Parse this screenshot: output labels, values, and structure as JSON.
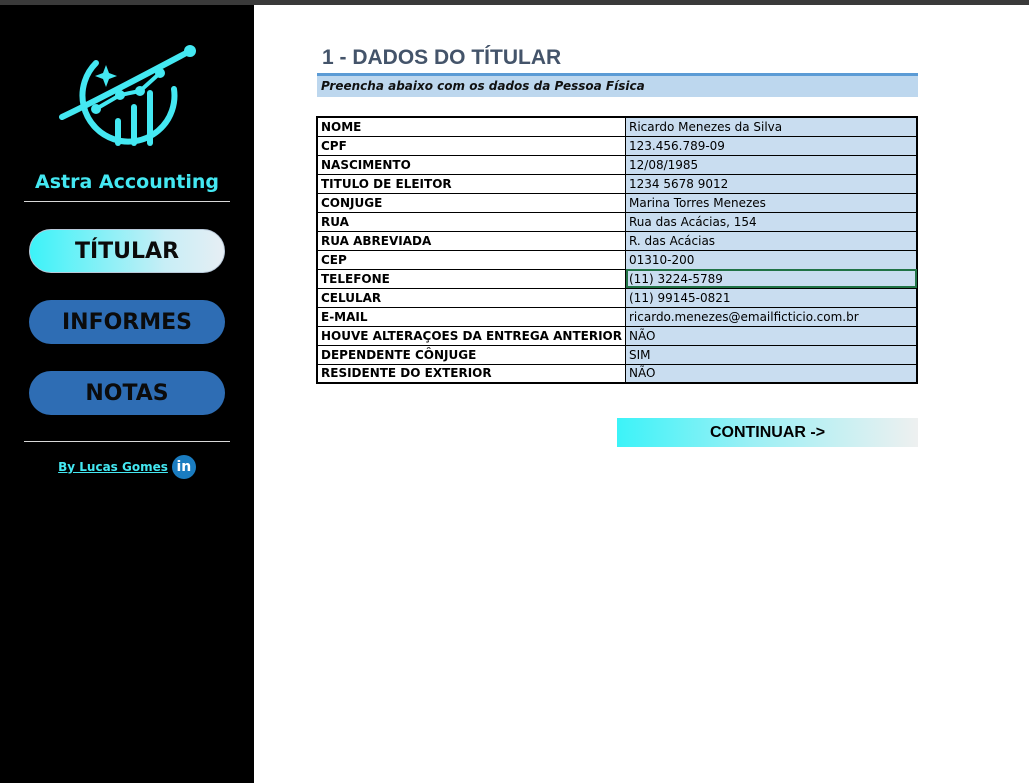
{
  "sidebar": {
    "brand": "Astra Accounting",
    "nav": [
      {
        "label": "TÍTULAR",
        "active": true
      },
      {
        "label": "INFORMES",
        "active": false
      },
      {
        "label": "NOTAS",
        "active": false
      }
    ],
    "credit": "By Lucas Gomes",
    "credit_icon": "linkedin-icon",
    "credit_icon_text": "in",
    "logo_icon": "growth-chart-orbit-icon"
  },
  "main": {
    "title": "1 - DADOS DO TÍTULAR",
    "subtitle": "Preencha abaixo com os dados da Pessoa Física",
    "rows": [
      {
        "label": "NOME",
        "value": "Ricardo Menezes da Silva"
      },
      {
        "label": "CPF",
        "value": "123.456.789-09"
      },
      {
        "label": "NASCIMENTO",
        "value": "12/08/1985"
      },
      {
        "label": "TITULO DE ELEITOR",
        "value": "1234 5678 9012"
      },
      {
        "label": "CONJUGE",
        "value": "Marina Torres Menezes"
      },
      {
        "label": "RUA",
        "value": "Rua das Acácias, 154"
      },
      {
        "label": "RUA ABREVIADA",
        "value": "R. das Acácias"
      },
      {
        "label": "CEP",
        "value": "01310-200"
      },
      {
        "label": "TELEFONE",
        "value": "(11) 3224-5789"
      },
      {
        "label": "CELULAR",
        "value": "(11) 99145-0821"
      },
      {
        "label": "E-MAIL",
        "value": "ricardo.menezes@emailficticio.com.br"
      },
      {
        "label": "HOUVE ALTERAÇOES DA ENTREGA ANTERIOR",
        "value": "NÃO"
      },
      {
        "label": "DEPENDENTE CÔNJUGE",
        "value": "SIM"
      },
      {
        "label": "RESIDENTE DO EXTERIOR",
        "value": "NÃO"
      }
    ],
    "selected_row": 8,
    "continue_label": "CONTINUAR ->"
  },
  "colors": {
    "accent_cyan": "#44e8f2",
    "nav_blue": "#2e6db4",
    "title_color": "#44546a",
    "cell_blue": "#c9ddf0",
    "subtitle_bg": "#bdd7ee"
  }
}
